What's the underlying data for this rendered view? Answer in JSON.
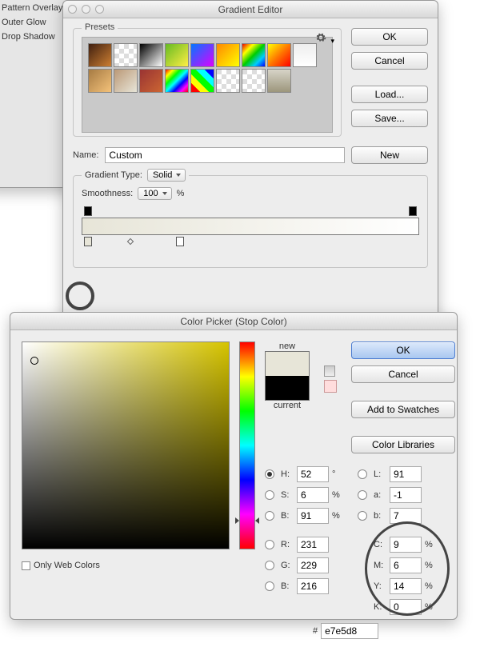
{
  "layer_styles": {
    "items": [
      "Pattern Overlay",
      "Outer Glow",
      "Drop Shadow"
    ]
  },
  "gradient_editor": {
    "title": "Gradient Editor",
    "presets_label": "Presets",
    "ok": "OK",
    "cancel": "Cancel",
    "load": "Load...",
    "save": "Save...",
    "name_label": "Name:",
    "name_value": "Custom",
    "new_btn": "New",
    "type_label": "Gradient Type:",
    "type_value": "Solid",
    "smoothness_label": "Smoothness:",
    "smoothness_value": "100",
    "percent": "%"
  },
  "color_picker": {
    "title": "Color Picker (Stop Color)",
    "ok": "OK",
    "cancel": "Cancel",
    "add_swatches": "Add to Swatches",
    "color_libraries": "Color Libraries",
    "new_label": "new",
    "current_label": "current",
    "only_web": "Only Web Colors",
    "H": {
      "label": "H:",
      "value": "52",
      "unit": "°"
    },
    "S": {
      "label": "S:",
      "value": "6",
      "unit": "%"
    },
    "Bhsb": {
      "label": "B:",
      "value": "91",
      "unit": "%"
    },
    "R": {
      "label": "R:",
      "value": "231"
    },
    "G": {
      "label": "G:",
      "value": "229"
    },
    "Brgb": {
      "label": "B:",
      "value": "216"
    },
    "L": {
      "label": "L:",
      "value": "91"
    },
    "a": {
      "label": "a:",
      "value": "-1"
    },
    "b": {
      "label": "b:",
      "value": "7"
    },
    "C": {
      "label": "C:",
      "value": "9",
      "unit": "%"
    },
    "M": {
      "label": "M:",
      "value": "6",
      "unit": "%"
    },
    "Y": {
      "label": "Y:",
      "value": "14",
      "unit": "%"
    },
    "K": {
      "label": "K:",
      "value": "0",
      "unit": "%"
    },
    "hex_label": "#",
    "hex_value": "e7e5d8",
    "new_color": "#e7e5d8",
    "current_color": "#000000"
  },
  "preset_colors": [
    [
      "linear-gradient(135deg,#402010,#cd7f32)",
      "repeating-conic-gradient(#fff 0 25%,#ddd 0 50%) 0 0/12px 12px",
      "linear-gradient(135deg,#000,#fff)",
      "linear-gradient(135deg,#6b2,#fe4)",
      "linear-gradient(135deg,#07f,#d0f)",
      "linear-gradient(135deg,#f80,#ff0)",
      "linear-gradient(135deg,#e00,#ff0,#0c0,#0cf,#00f)",
      "linear-gradient(135deg,#ff0,#f70,#f00)",
      "linear-gradient(#eee,#fff)"
    ],
    [
      "linear-gradient(135deg,#a67b43,#f4c27a)",
      "linear-gradient(135deg,#b97,#e7e5d8)",
      "linear-gradient(135deg,#933,#c63)",
      "linear-gradient(135deg,#f00,#ff0,#0f0,#0ff,#00f,#f0f,#f00)",
      "linear-gradient(45deg,#f00 0 20%,#ff0 0 40%,#0f0 0 60%,#0ff 0 80%,#00f 0)",
      "repeating-conic-gradient(#fff 0 25%,#ddd 0 50%) 0 0/12px 12px",
      "repeating-conic-gradient(#fff 0 25%,#ddd 0 50%) 0 0/12px 12px",
      "linear-gradient(#d7d4c8,#9c967c)"
    ]
  ]
}
